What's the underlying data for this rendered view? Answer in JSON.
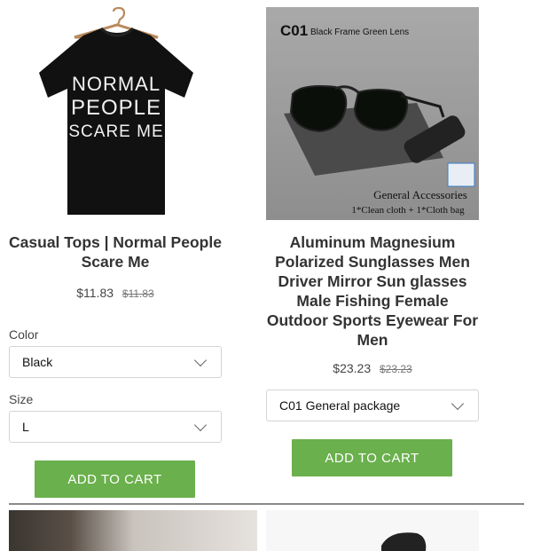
{
  "products": [
    {
      "title": "Casual Tops | Normal People Scare Me",
      "image_text": "NORMAL PEOPLE SCARE ME",
      "price": "$11.83",
      "compare_price": "$11.83",
      "options": [
        {
          "label": "Color",
          "value": "Black"
        },
        {
          "label": "Size",
          "value": "L"
        }
      ],
      "cart_label": "ADD TO CART"
    },
    {
      "title": "Aluminum Magnesium Polarized Sunglasses Men Driver Mirror Sun glasses Male Fishing Female Outdoor Sports Eyewear For Men",
      "image_code": "C01",
      "image_caption": "Black Frame Green Lens",
      "image_note_1": "General Accessories",
      "image_note_2": "1*Clean cloth + 1*Cloth bag",
      "price": "$23.23",
      "compare_price": "$23.23",
      "options": [
        {
          "label": "",
          "value": "C01 General package"
        }
      ],
      "cart_label": "ADD TO CART"
    }
  ],
  "colors": {
    "accent_green": "#6ab04c"
  },
  "icons": {
    "select_chevron": "chevron-down-icon"
  }
}
